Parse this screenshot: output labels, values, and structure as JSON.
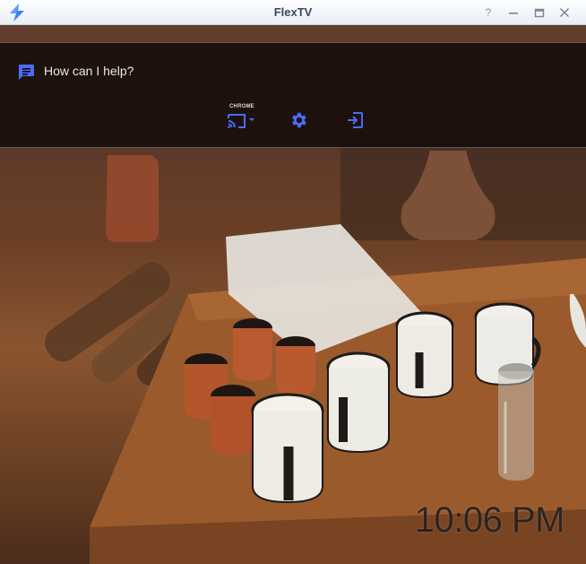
{
  "window": {
    "title": "FlexTV",
    "help_label": "?"
  },
  "assistant": {
    "prompt": "How can I help?",
    "cast_device": "CHROME"
  },
  "clock": {
    "time": "10:06 PM"
  },
  "colors": {
    "accent": "#4a6cf7",
    "overlay": "#120a08",
    "titlebar": "#eef2f7"
  },
  "icons": {
    "app": "flextv-logo-icon",
    "chat": "chat-bubble-icon",
    "cast": "cast-icon",
    "settings": "gear-icon",
    "exit": "exit-icon"
  }
}
